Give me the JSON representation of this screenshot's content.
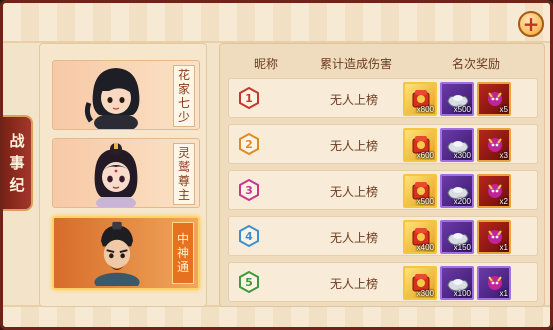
{
  "side_tab": {
    "chars": [
      "战",
      "事",
      "纪"
    ]
  },
  "characters": [
    {
      "name_chars": [
        "花",
        "家",
        "七",
        "少"
      ],
      "selected": false
    },
    {
      "name_chars": [
        "灵",
        "鹫",
        "尊",
        "主"
      ],
      "selected": false
    },
    {
      "name_chars": [
        "中",
        "神",
        "通"
      ],
      "selected": true
    }
  ],
  "table": {
    "headers": {
      "nickname": "昵称",
      "damage": "累计造成伤害",
      "reward": "名次奖励"
    },
    "rows": [
      {
        "rank": "1",
        "damage": "无人上榜",
        "rewards": [
          "x800",
          "x500",
          "x5"
        ],
        "badge_color": "#c9372a"
      },
      {
        "rank": "2",
        "damage": "无人上榜",
        "rewards": [
          "x600",
          "x300",
          "x3"
        ],
        "badge_color": "#e08a25"
      },
      {
        "rank": "3",
        "damage": "无人上榜",
        "rewards": [
          "x500",
          "x200",
          "x2"
        ],
        "badge_color": "#c7368f"
      },
      {
        "rank": "4",
        "damage": "无人上榜",
        "rewards": [
          "x400",
          "x150",
          "x1"
        ],
        "badge_color": "#3e8fd0"
      },
      {
        "rank": "5",
        "damage": "无人上榜",
        "rewards": [
          "x300",
          "x100",
          "x1"
        ],
        "badge_color": "#3e9a3a"
      }
    ]
  },
  "icons": {
    "add": "plus-icon",
    "reward_types": [
      "red-packet-icon",
      "silver-ingot-icon",
      "demon-item-icon"
    ]
  }
}
